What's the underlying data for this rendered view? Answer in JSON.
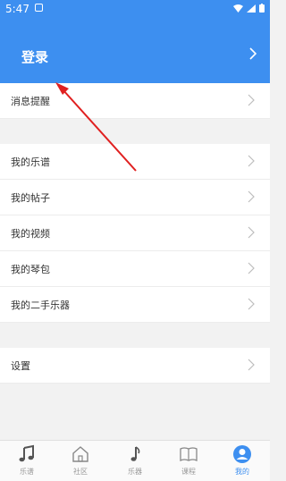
{
  "status_bar": {
    "time": "5:47"
  },
  "header": {
    "login_label": "登录"
  },
  "rows": {
    "messages": "消息提醒",
    "scores": "我的乐谱",
    "posts": "我的帖子",
    "videos": "我的视频",
    "case": "我的琴包",
    "secondhand": "我的二手乐器",
    "settings": "设置"
  },
  "tabbar": {
    "tabs": [
      {
        "label": "乐谱",
        "icon": "music-note-icon"
      },
      {
        "label": "社区",
        "icon": "home-icon"
      },
      {
        "label": "乐器",
        "icon": "eighth-note-icon"
      },
      {
        "label": "课程",
        "icon": "book-icon"
      },
      {
        "label": "我的",
        "icon": "profile-icon"
      }
    ]
  },
  "colors": {
    "accent": "#3d8ff0",
    "annotation": "#e02020"
  }
}
